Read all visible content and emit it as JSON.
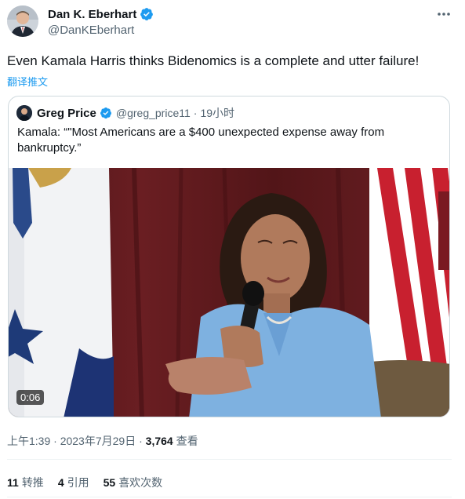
{
  "author": {
    "name": "Dan K. Eberhart",
    "handle": "@DanKEberhart",
    "verified_icon": "verified-badge-icon"
  },
  "tweet": {
    "text": "Even Kamala Harris thinks Bidenomics is a complete and utter failure!",
    "translate_label": "翻译推文"
  },
  "quoted": {
    "name": "Greg Price",
    "handle": "@greg_price11",
    "separator": "·",
    "time": "19小时",
    "text": "Kamala: “\"Most Americans are a $400 unexpected expense away from bankruptcy.”",
    "video_duration": "0:06"
  },
  "meta": {
    "time": "上午1:39",
    "sep1": "·",
    "date": "2023年7月29日",
    "sep2": "·",
    "views_count": "3,764",
    "views_label": "查看"
  },
  "stats": {
    "retweets_count": "11",
    "retweets_label": "转推",
    "quotes_count": "4",
    "quotes_label": "引用",
    "likes_count": "55",
    "likes_label": "喜欢次数"
  },
  "colors": {
    "accent": "#1d9bf0",
    "secondary_text": "#536471",
    "primary_text": "#0f1419",
    "border": "#cfd9de"
  }
}
